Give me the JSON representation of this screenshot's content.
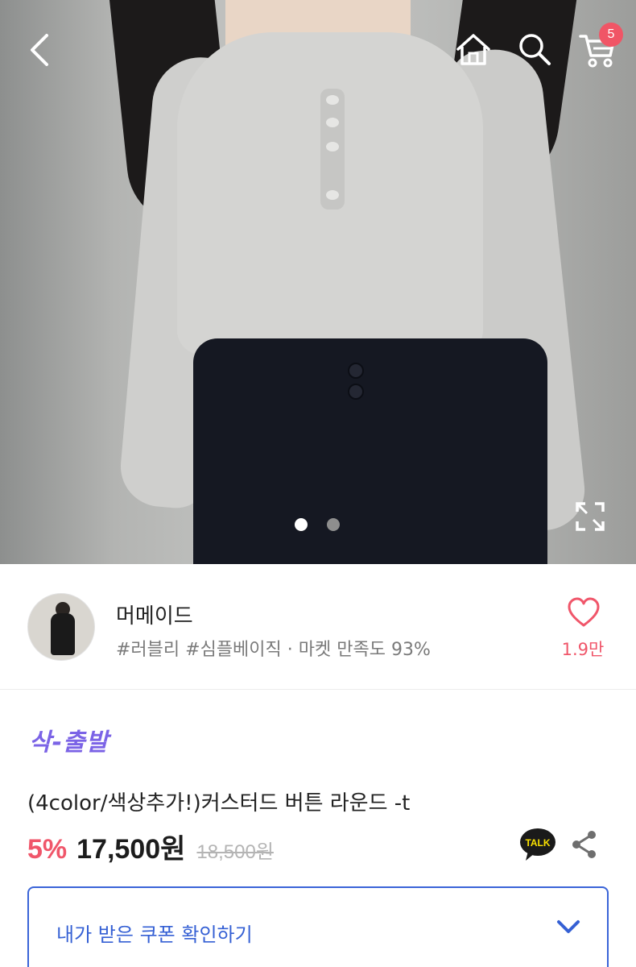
{
  "header": {
    "cart_count": "5",
    "icons": [
      "back-icon",
      "home-icon",
      "search-icon",
      "cart-icon",
      "expand-icon"
    ]
  },
  "carousel": {
    "total": 2,
    "active": 1
  },
  "seller": {
    "name": "머메이드",
    "tags": "#러블리 #심플베이직 · 마켓 만족도 93%",
    "like_count": "1.9만"
  },
  "product": {
    "promo": "삭-출발",
    "title": "(4color/색상추가!)커스터드 버튼 라운드 -t",
    "discount": "5%",
    "price": "17,500원",
    "original_price": "18,500원"
  },
  "coupon": {
    "label": "내가 받은 쿠폰 확인하기"
  },
  "colors": {
    "accent_pink": "#f0566a",
    "promo_purple": "#7b63e6",
    "coupon_blue": "#3a64d8"
  }
}
